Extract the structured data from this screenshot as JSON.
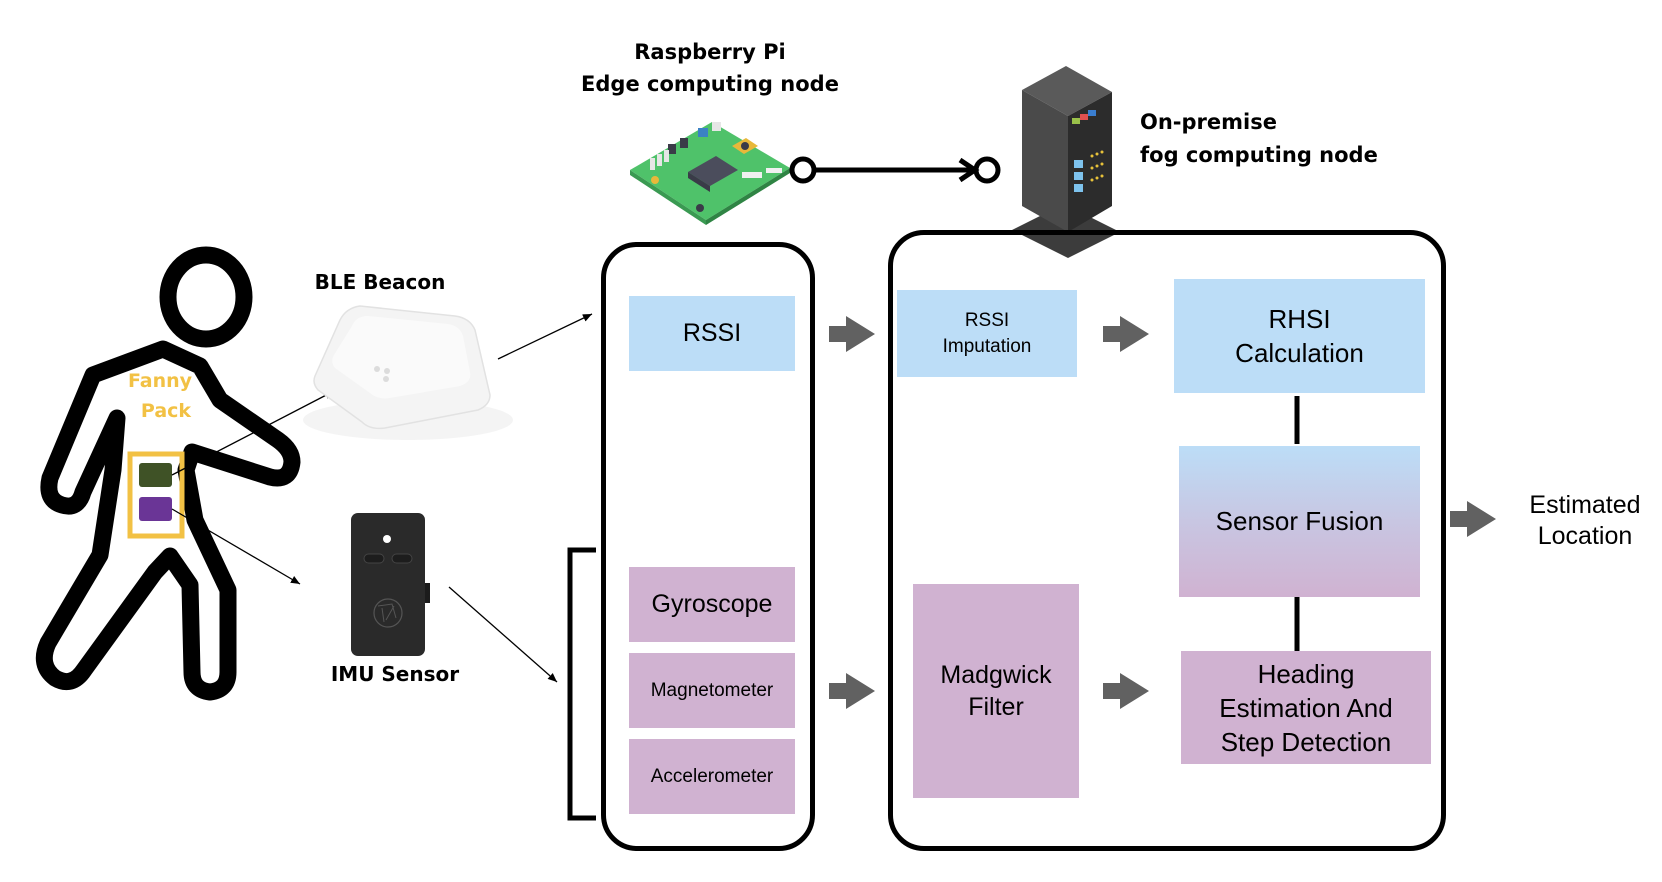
{
  "labels": {
    "edge_node": [
      "Raspberry Pi",
      "Edge computing node"
    ],
    "fog_node": [
      "On-premise",
      "fog computing node"
    ],
    "ble_beacon": "BLE Beacon",
    "imu_sensor": "IMU Sensor",
    "fanny_pack": [
      "Fanny",
      "Pack"
    ],
    "output": [
      "Estimated",
      "Location"
    ]
  },
  "edge_box": {
    "rssi": "RSSI",
    "imu_components": [
      "Gyroscope",
      "Magnetometer",
      "Accelerometer"
    ]
  },
  "fog_box": {
    "rssi_imputation": [
      "RSSI",
      "Imputation"
    ],
    "madgwick_filter": [
      "Madgwick",
      "Filter"
    ],
    "rhsi_calculation": [
      "RHSI",
      "Calculation"
    ],
    "sensor_fusion": "Sensor Fusion",
    "heading_step": [
      "Heading",
      "Estimation And",
      "Step Detection"
    ]
  },
  "colors": {
    "rssi_blue": "#bcddf7",
    "imu_purple": "#d0b2d1",
    "fanny_pack_yellow": "#f2c144",
    "beacon_device_green": "#3f5226",
    "imu_device_purple": "#6a3596",
    "arrow_gray": "#616161"
  }
}
